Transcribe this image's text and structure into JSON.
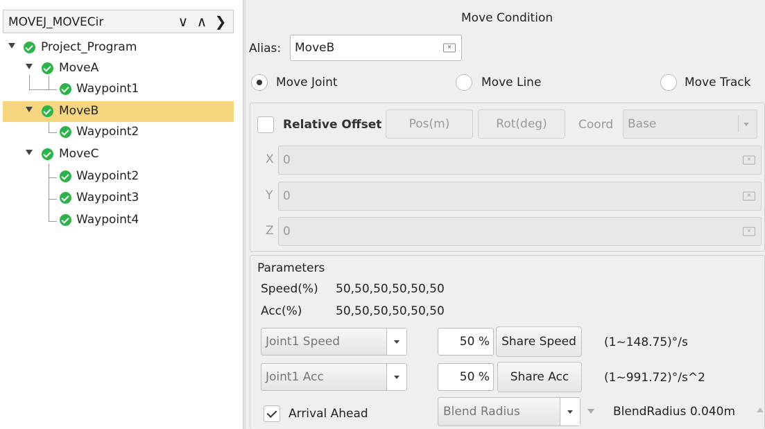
{
  "tree": {
    "title": "MOVEJ_MOVECir",
    "header_icons": [
      "chevron-down-icon",
      "chevron-up-icon",
      "chevron-right-icon"
    ],
    "items": [
      {
        "label": "Project_Program",
        "level": 0,
        "expanded": true,
        "selected": false
      },
      {
        "label": "MoveA",
        "level": 1,
        "expanded": true,
        "selected": false
      },
      {
        "label": "Waypoint1",
        "level": 2,
        "selected": false
      },
      {
        "label": "MoveB",
        "level": 1,
        "expanded": true,
        "selected": true
      },
      {
        "label": "Waypoint2",
        "level": 2,
        "selected": false
      },
      {
        "label": "MoveC",
        "level": 1,
        "expanded": true,
        "selected": false
      },
      {
        "label": "Waypoint2",
        "level": 2,
        "selected": false
      },
      {
        "label": "Waypoint3",
        "level": 2,
        "selected": false
      },
      {
        "label": "Waypoint4",
        "level": 2,
        "selected": false
      }
    ]
  },
  "move_condition": {
    "title": "Move Condition",
    "alias_label": "Alias:",
    "alias_value": "MoveB",
    "move_types": [
      {
        "label": "Move Joint",
        "selected": true
      },
      {
        "label": "Move Line",
        "selected": false
      },
      {
        "label": "Move Track",
        "selected": false
      }
    ]
  },
  "offset": {
    "relative_offset_label": "Relative Offset",
    "relative_offset_checked": false,
    "pos_button": "Pos(m)",
    "rot_button": "Rot(deg)",
    "coord_label": "Coord",
    "coord_value": "Base",
    "fields": [
      {
        "label": "X",
        "value": "0"
      },
      {
        "label": "Y",
        "value": "0"
      },
      {
        "label": "Z",
        "value": "0"
      }
    ]
  },
  "parameters": {
    "title": "Parameters",
    "speed_label": "Speed(%)",
    "speed_value": "50,50,50,50,50,50",
    "acc_label": "Acc(%)",
    "acc_value": "50,50,50,50,50,50",
    "joint_speed_select": "Joint1 Speed",
    "joint_speed_percent": "50 %",
    "share_speed_button": "Share Speed",
    "speed_range": "(1~148.75)°/s",
    "joint_acc_select": "Joint1 Acc",
    "joint_acc_percent": "50 %",
    "share_acc_button": "Share Acc",
    "acc_range": "(1~991.72)°/s^2",
    "arrival_ahead_label": "Arrival Ahead",
    "arrival_ahead_checked": true,
    "blend_select": "Blend Radius",
    "blend_radius_text": "BlendRadius 0.040m"
  }
}
